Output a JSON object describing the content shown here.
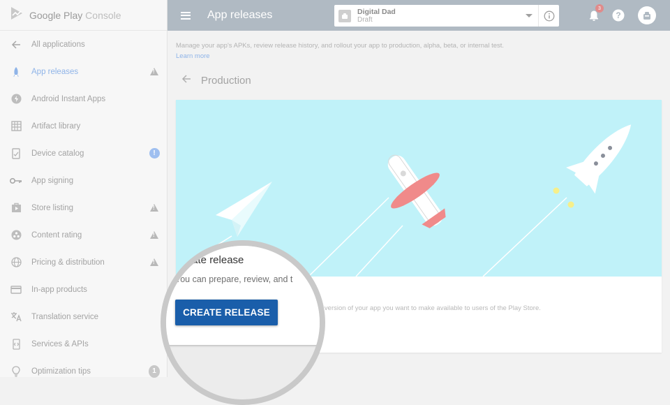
{
  "brand": {
    "name": "Google Play",
    "product": "Console"
  },
  "sidebar": {
    "back_label": "All applications",
    "items": [
      {
        "label": "App releases",
        "icon": "rocket-icon",
        "badge": "warning",
        "active": true
      },
      {
        "label": "Android Instant Apps",
        "icon": "lightning-icon",
        "badge": ""
      },
      {
        "label": "Artifact library",
        "icon": "grid-icon",
        "badge": ""
      },
      {
        "label": "Device catalog",
        "icon": "device-icon",
        "badge": "info"
      },
      {
        "label": "App signing",
        "icon": "key-icon",
        "badge": ""
      },
      {
        "label": "Store listing",
        "icon": "store-icon",
        "badge": "warning"
      },
      {
        "label": "Content rating",
        "icon": "rating-icon",
        "badge": "warning"
      },
      {
        "label": "Pricing & distribution",
        "icon": "globe-icon",
        "badge": "warning"
      },
      {
        "label": "In-app products",
        "icon": "card-icon",
        "badge": ""
      },
      {
        "label": "Translation service",
        "icon": "translate-icon",
        "badge": ""
      },
      {
        "label": "Services & APIs",
        "icon": "api-icon",
        "badge": ""
      },
      {
        "label": "Optimization tips",
        "icon": "bulb-icon",
        "badge": "1"
      }
    ],
    "info_badge": "!"
  },
  "topbar": {
    "title": "App releases",
    "app_name": "Digital Dad",
    "app_status": "Draft",
    "notification_count": "3"
  },
  "main": {
    "intro": "Manage your app's APKs, review release history, and rollout your app to production, alpha, beta, or internal test.",
    "learn_more": "Learn more",
    "section_title": "Production",
    "card_description": "e version of your app you want to make available to users of the Play Store."
  },
  "lens": {
    "title": "Create release",
    "subtitle": "You can prepare, review, and t",
    "button_label": "CREATE RELEASE"
  },
  "colors": {
    "topbar": "#b0bac3",
    "hero": "#c0f2f9",
    "primary_button": "#1a5eaa",
    "accent": "#8fb4e8"
  }
}
